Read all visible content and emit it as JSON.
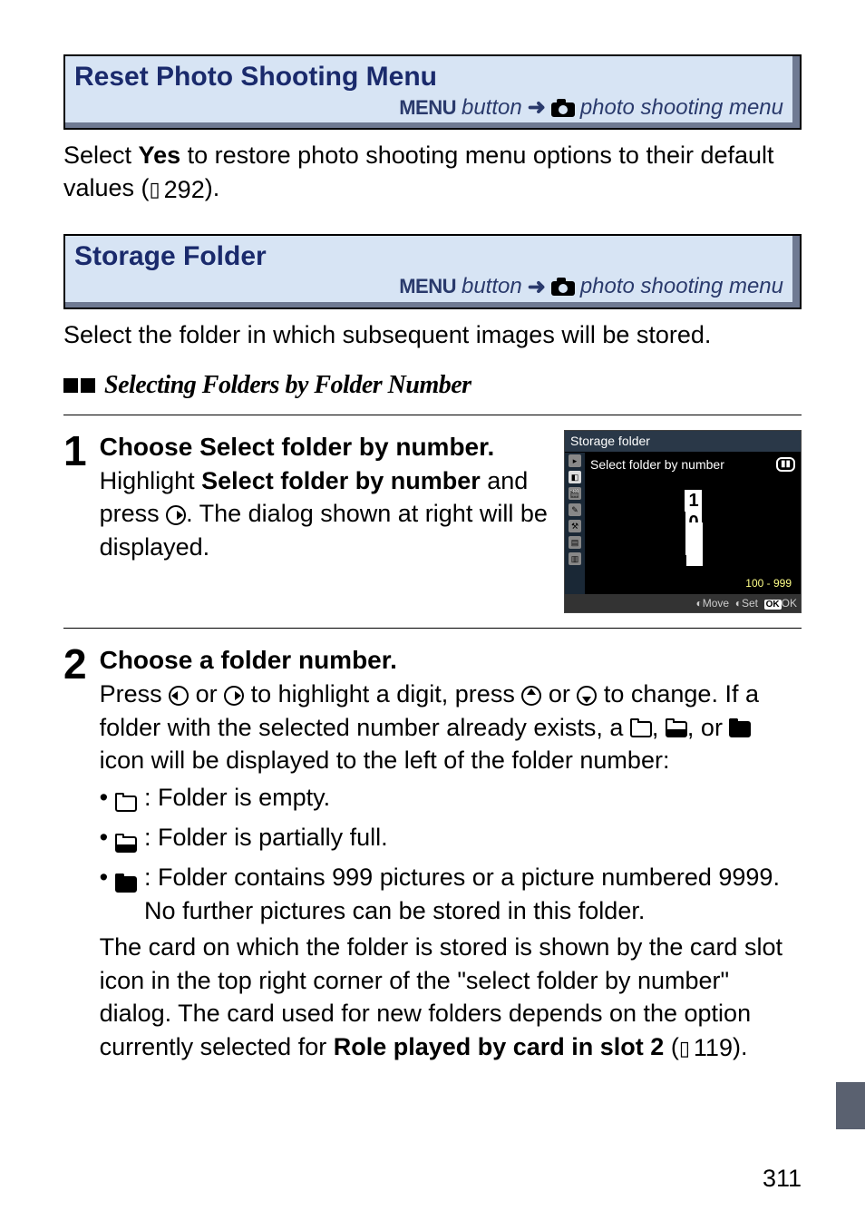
{
  "sections": {
    "reset": {
      "title": "Reset Photo Shooting Menu",
      "menu_button": "MENU",
      "button_word": "button",
      "menu_name": "photo shooting menu",
      "body_pre": "Select ",
      "body_bold": "Yes",
      "body_post": " to restore photo shooting menu options to their default values (",
      "body_ref": "292",
      "body_end": ")."
    },
    "storage": {
      "title": "Storage Folder",
      "menu_button": "MENU",
      "button_word": "button",
      "menu_name": "photo shooting menu",
      "body": "Select the folder in which subsequent images will be stored."
    }
  },
  "subheading": "Selecting Folders by Folder Number",
  "step1": {
    "num": "1",
    "title_pre": "Choose ",
    "title_bold": "Select folder by number",
    "title_post": ".",
    "line1_pre": "Highlight ",
    "line1_bold": "Select folder by number",
    "line1_post": " and press ",
    "line1_end": ".  The dialog shown at right will be displayed."
  },
  "screenshot": {
    "title": "Storage folder",
    "subtitle": "Select folder by number",
    "d1": "1",
    "d2": "0",
    "d3": "1",
    "range": "100 - 999",
    "move": "Move",
    "set": "Set",
    "ok": "OK",
    "okword": "OK"
  },
  "step2": {
    "num": "2",
    "title": "Choose a folder number.",
    "p1a": "Press ",
    "p1b": " or ",
    "p1c": " to highlight a digit, press ",
    "p1d": " or ",
    "p1e": " to change.  If a folder with the selected number already exists, a ",
    "p1f": ", ",
    "p1g": ", or ",
    "p1h": " icon will be displayed to the left of the folder number:",
    "li1": ": Folder is empty.",
    "li2": ": Folder is partially full.",
    "li3": ": Folder contains 999 pictures or a picture numbered 9999.  No further pictures can be stored in this folder.",
    "p2a": "The card on which the folder is stored is shown by the card slot icon in the top right corner of the \"select folder by number\" dialog. The card used for new folders depends on the option currently selected for ",
    "p2bold": "Role played by card in slot 2",
    "p2b": " (",
    "p2ref": "119",
    "p2c": ")."
  },
  "page_number": "311"
}
